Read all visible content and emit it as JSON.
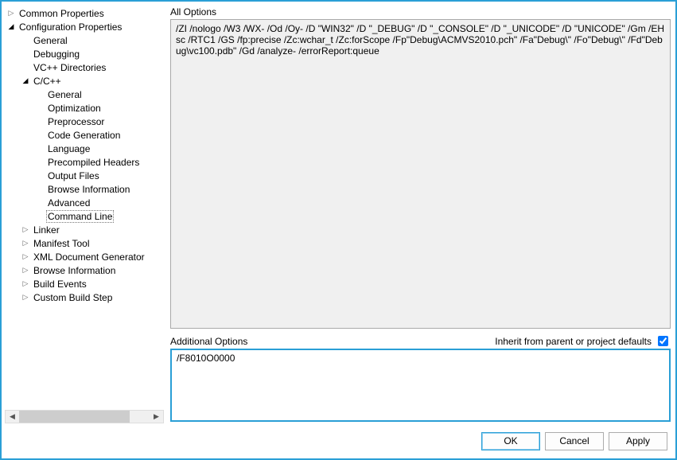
{
  "tree": {
    "common_properties": "Common Properties",
    "configuration_properties": "Configuration Properties",
    "general": "General",
    "debugging": "Debugging",
    "vc_directories": "VC++ Directories",
    "c_cpp": "C/C++",
    "cc_general": "General",
    "cc_optimization": "Optimization",
    "cc_preprocessor": "Preprocessor",
    "cc_code_generation": "Code Generation",
    "cc_language": "Language",
    "cc_precompiled": "Precompiled Headers",
    "cc_output_files": "Output Files",
    "cc_browse_info": "Browse Information",
    "cc_advanced": "Advanced",
    "cc_command_line": "Command Line",
    "linker": "Linker",
    "manifest_tool": "Manifest Tool",
    "xml_doc_gen": "XML Document Generator",
    "browse_information": "Browse Information",
    "build_events": "Build Events",
    "custom_build_step": "Custom Build Step"
  },
  "right": {
    "all_options_label": "All Options",
    "all_options_value": "/ZI /nologo /W3 /WX- /Od /Oy- /D \"WIN32\" /D \"_DEBUG\" /D \"_CONSOLE\" /D \"_UNICODE\" /D \"UNICODE\" /Gm /EHsc /RTC1 /GS /fp:precise /Zc:wchar_t /Zc:forScope /Fp\"Debug\\ACMVS2010.pch\" /Fa\"Debug\\\" /Fo\"Debug\\\" /Fd\"Debug\\vc100.pdb\" /Gd /analyze- /errorReport:queue",
    "additional_label": "Additional Options",
    "inherit_label": "Inherit from parent or project defaults",
    "additional_value": "/F8010O0000"
  },
  "buttons": {
    "ok": "OK",
    "cancel": "Cancel",
    "apply": "Apply"
  }
}
